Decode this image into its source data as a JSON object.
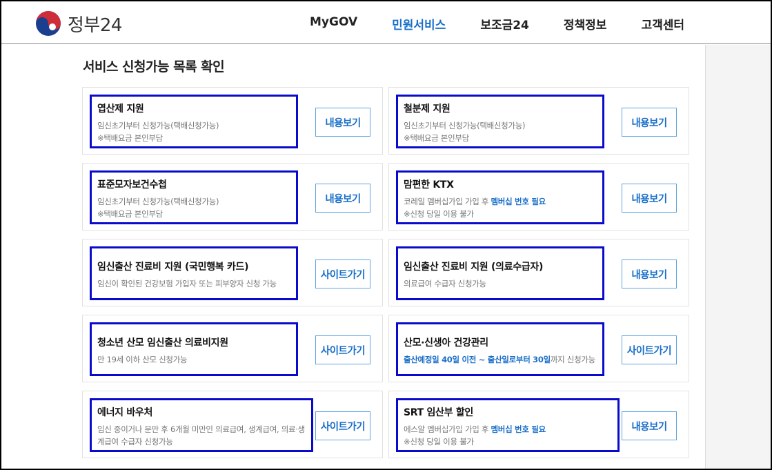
{
  "header": {
    "logo_text": "정부24",
    "nav": [
      {
        "label": "MyGOV"
      },
      {
        "label": "민원서비스"
      },
      {
        "label": "보조금24"
      },
      {
        "label": "정책정보"
      },
      {
        "label": "고객센터"
      }
    ]
  },
  "section_title": "서비스 신청가능 목록 확인",
  "colors": {
    "accent": "#1a6fc9",
    "highlight_border": "#0a0acc"
  },
  "cards": [
    {
      "title": "엽산제 지원",
      "desc1": "임신초기부터 신청가능(택배신청가능)",
      "desc2": "※택배요금 본인부담",
      "button": "내용보기"
    },
    {
      "title": "철분제 지원",
      "desc1": "임신초기부터 신청가능(택배신청가능)",
      "desc2": "※택배요금 본인부담",
      "button": "내용보기"
    },
    {
      "title": "표준모자보건수첩",
      "desc1": "임신초기부터 신청가능(택배신청가능)",
      "desc2": "※택배요금 본인부담",
      "button": "내용보기"
    },
    {
      "title": "맘편한 KTX",
      "desc1_a": "코레일 멤버십가입 가입 후 ",
      "desc1_hl": "멤버십 번호 필요",
      "desc2": "※신청 당일 이용 불가",
      "button": "내용보기"
    },
    {
      "title": "임신출산 진료비 지원 (국민행복 카드)",
      "desc1": "임신이 확인된 건강보험 가입자 또는 피부양자 신청 가능",
      "button": "사이트가기"
    },
    {
      "title": "임신출산 진료비 지원 (의료수급자)",
      "desc1": "의료급여 수급자 신청가능",
      "button": "내용보기"
    },
    {
      "title": "청소년 산모 임신출산 의료비지원",
      "desc1": "만 19세 이하 산모 신청가능",
      "button": "사이트가기"
    },
    {
      "title": "산모·신생아 건강관리",
      "desc1_hl": "출산예정일 40일 이전 ~ 출산일로부터 30일",
      "desc1_b": "까지 신청가능",
      "button": "사이트가기"
    },
    {
      "title": "에너지 바우처",
      "desc1": "임신 중이거나 분만 후 6개월 미만인 의료급여, 생계급여, 의료·생계급여 수급자 신청가능",
      "button": "사이트가기"
    },
    {
      "title": "SRT 임산부 할인",
      "desc1_a": "에스알 멤버십가입 가입 후 ",
      "desc1_hl": "멤버십 번호 필요",
      "desc2": "※신청 당일 이용 불가",
      "button": "내용보기"
    }
  ]
}
